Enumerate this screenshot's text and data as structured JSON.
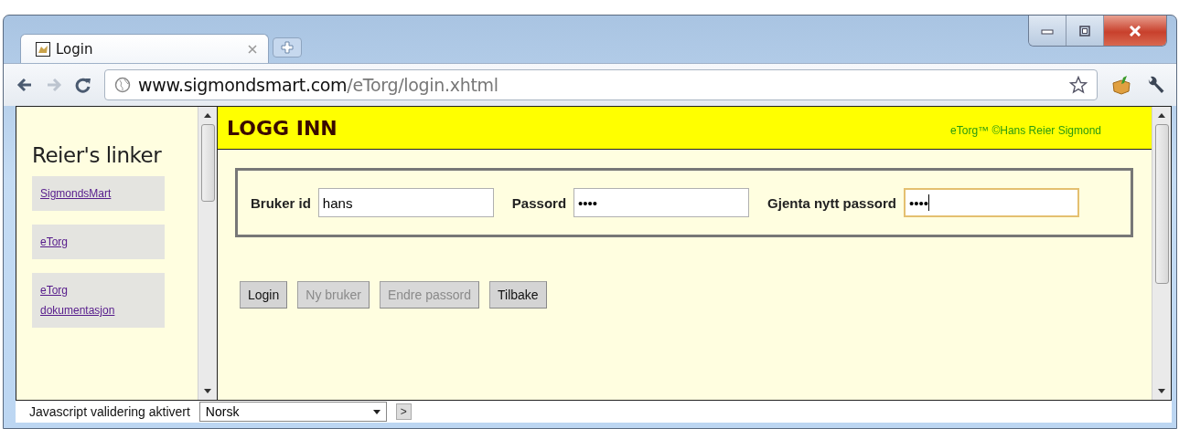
{
  "tabs": [
    {
      "label": "Login",
      "selected": true
    }
  ],
  "address": {
    "host": "www.sigmondsmart.com",
    "path": "/eTorg/login.xhtml"
  },
  "sidebar": {
    "title": "Reier's linker",
    "links": [
      "SigmondsMart",
      "eTorg",
      "eTorg dokumentasjon"
    ]
  },
  "header": {
    "title": "LOGG INN",
    "credit": "eTorg™ ©Hans Reier Sigmond"
  },
  "fields": [
    {
      "label": "Bruker id",
      "value": "hans",
      "focused": false
    },
    {
      "label": "Passord",
      "value": "••••",
      "focused": false
    },
    {
      "label": "Gjenta nytt passord",
      "value": "••••",
      "focused": true
    }
  ],
  "buttons": [
    {
      "label": "Login",
      "disabled": false
    },
    {
      "label": "Ny bruker",
      "disabled": true
    },
    {
      "label": "Endre passord",
      "disabled": true
    },
    {
      "label": "Tilbake",
      "disabled": false
    }
  ],
  "status": {
    "text": "Javascript validering aktivert",
    "language": "Norsk",
    "next": ">"
  }
}
